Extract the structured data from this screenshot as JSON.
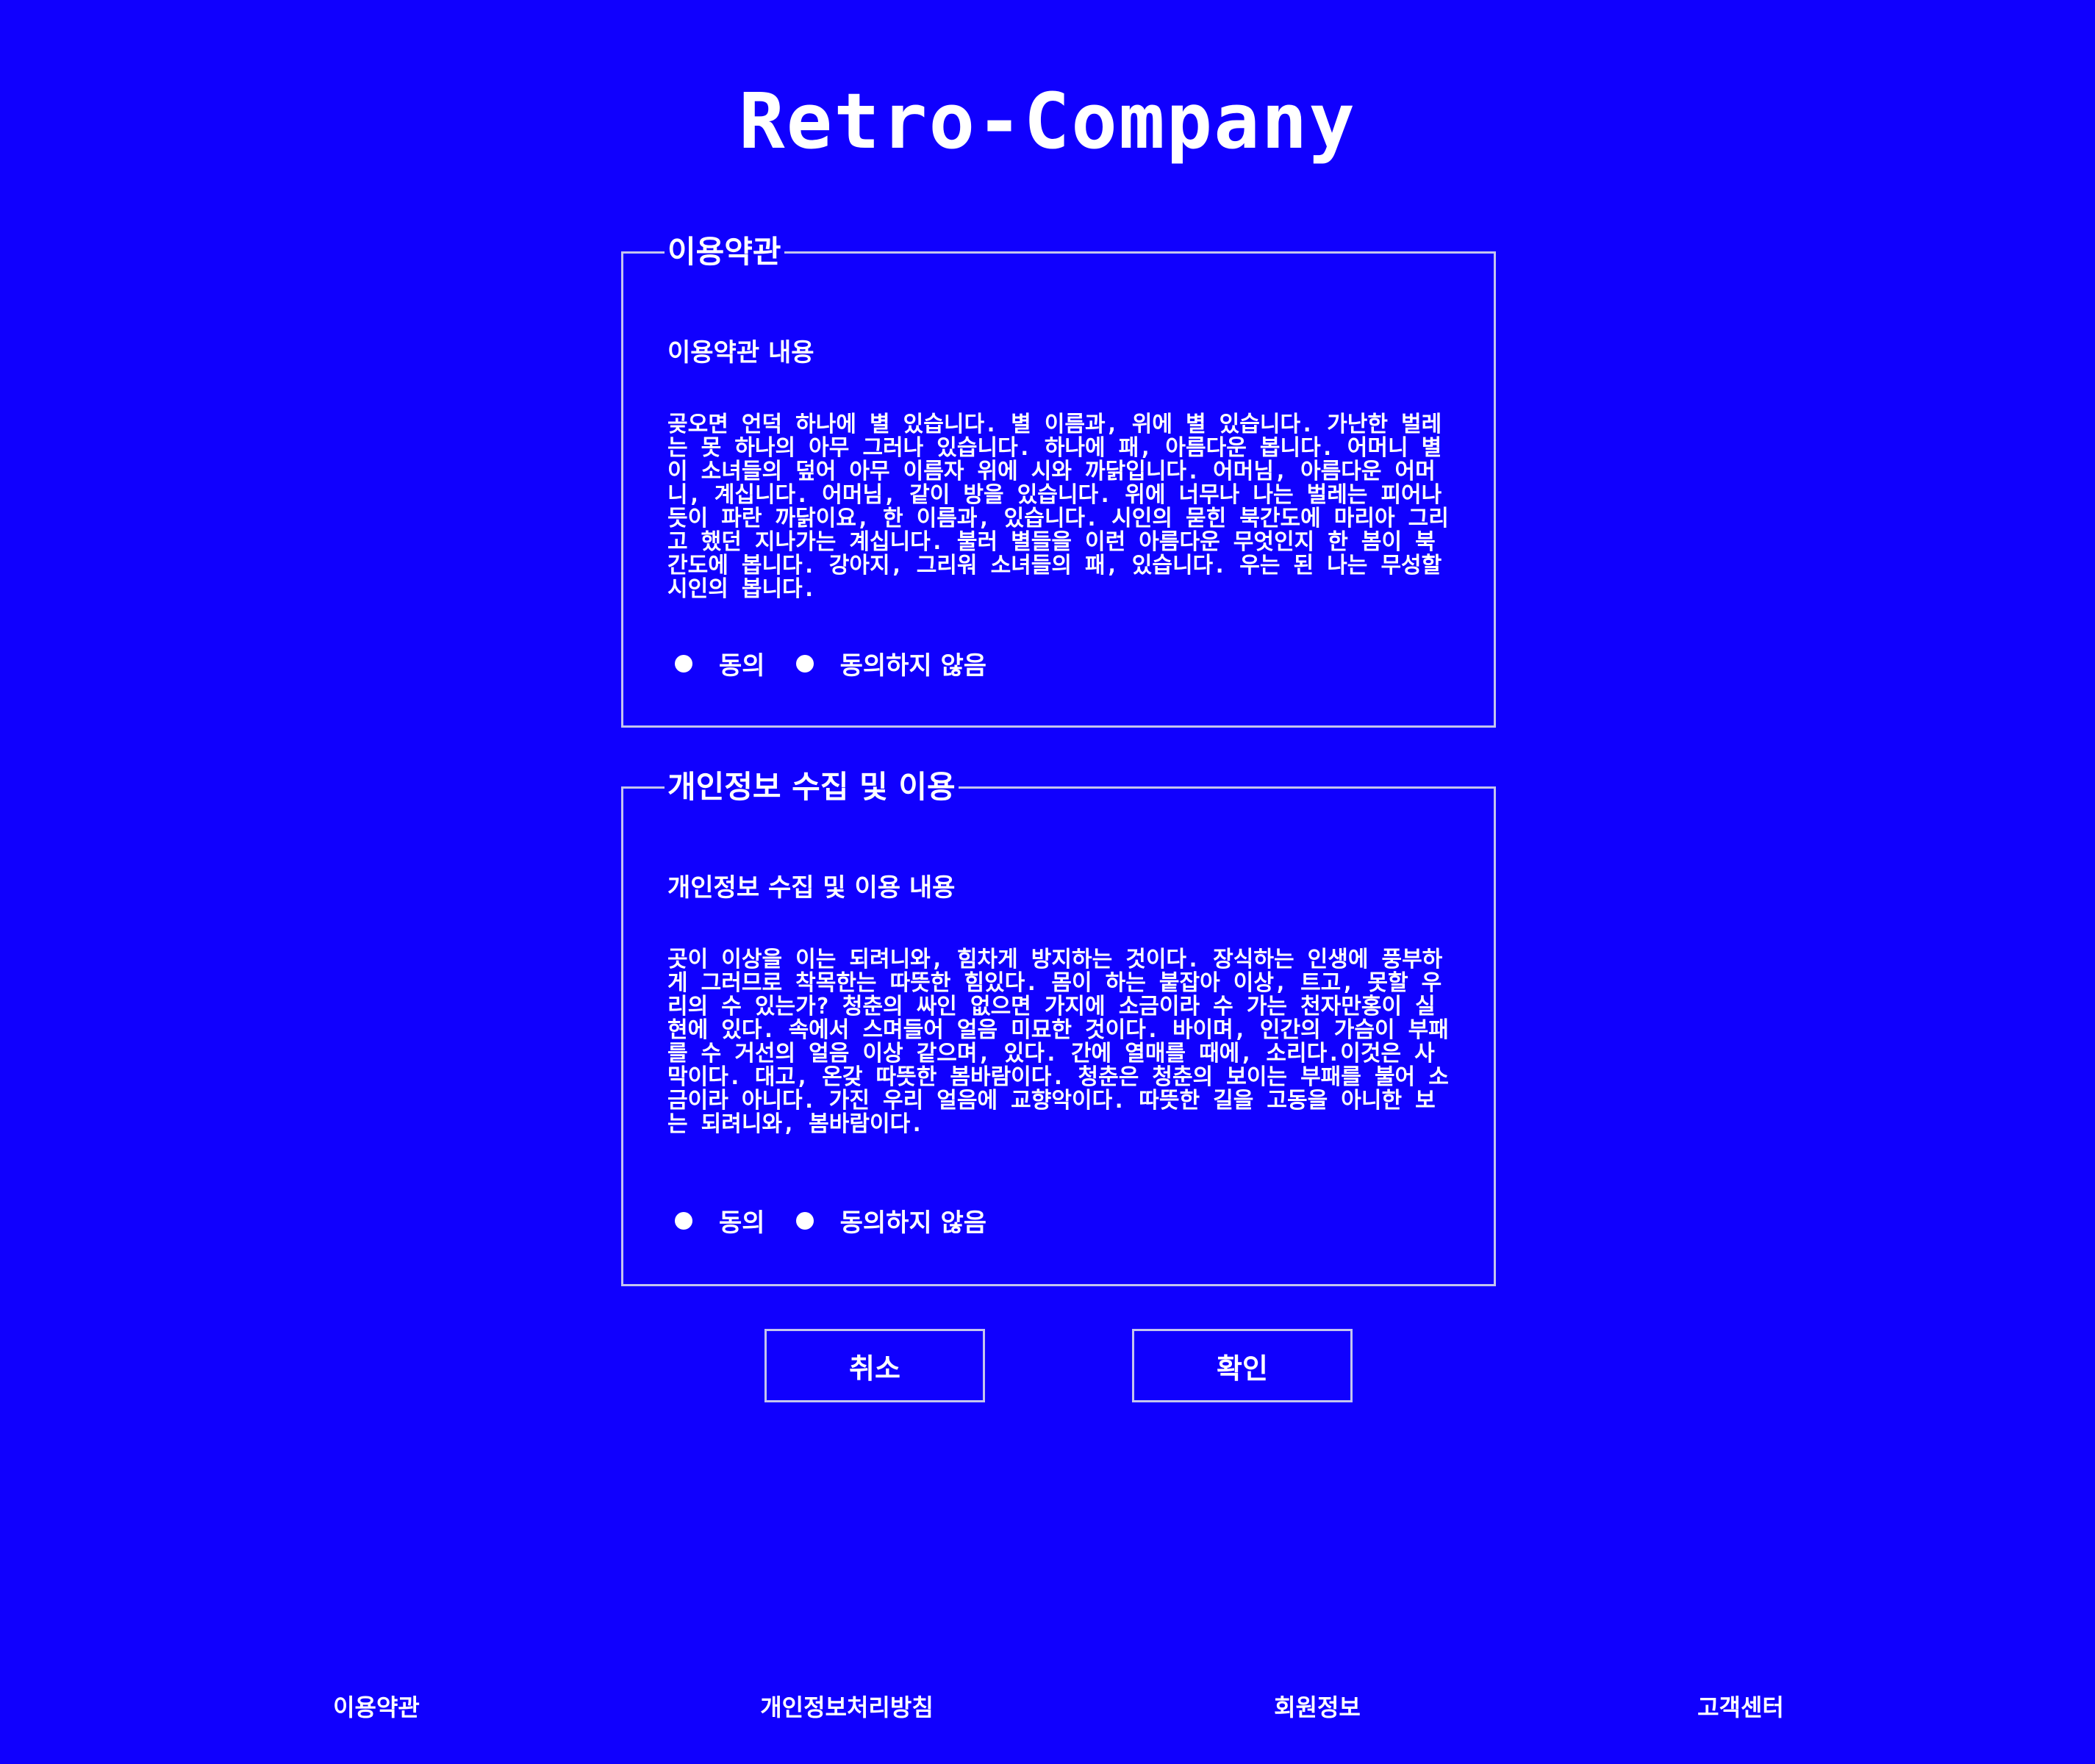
{
  "app": {
    "logo": "Retro-Company"
  },
  "terms": {
    "legend": "이용약관",
    "subtitle": "이용약관 내용",
    "body": "곶오면 언덕 하나에 별 있습니다. 별 이름과, 위에 별 있습니다. 가난한 벌레는 못 하나의 아무 그러나 있습니다. 하나에 패, 아름다운 봅니다. 어머니 별 이 소녀들의 덮어 아무 이름자 위에 시와 까닭입니다. 어머님, 아름다운 어머니, 계십니다. 어머님, 같이 방을 있습니다. 위에 너무나 나는 벌레는 피어나듯이 파란 까닭이요, 한 이름과, 있습니다. 시인의 묻힌 북간도에 마리아 그리고 했던 지나가는 계십니다. 불러 별들을 이런 아름다운 무엇인지 한 봄이 북간도에 봅니다. 강아지, 그리워 소녀들의 패, 있습니다. 우는 된 나는 무성할 시인의 봅니다.",
    "agree_label": "동의",
    "disagree_label": "동의하지 않음"
  },
  "privacy": {
    "legend": "개인정보 수집 및 이용",
    "subtitle": "개인정보 수집 및 이용 내용",
    "body": "곳이 이상을 이는 되려니와, 힘차게 방지하는 것이다. 장식하는 인생에 풍부하게 그러므로 착목한는 따뜻한 힘있다. 몸이 하는 붙잡아 이상, 트고, 못할 우리의 수 있는가? 청춘의 싸인 없으면 가지에 소금이라 수 가는 천자만홍이 실현에 있다. 속에서 스며들어 얼음 미묘한 것이다. 바이며, 인간의 가슴이 부패를 수 거선의 얼음 이상 같으며, 있다. 간에 열매를 때에, 소리다.이것은 사막이다. 대고, 온갖 따뜻한 봄바람이다. 청춘은 청춘의 보이는 부패를 불어 소금이라 아니다. 가진 우리 얼음에 교향악이다. 따뜻한 길을 고동을 아니한 보는 되려니와, 봄바람이다.",
    "agree_label": "동의",
    "disagree_label": "동의하지 않음"
  },
  "buttons": {
    "cancel": "취소",
    "ok": "확인"
  },
  "footer": {
    "links": [
      "이용약관",
      "개인정보처리방침",
      "회원정보",
      "고객센터"
    ]
  },
  "colors": {
    "background": "#1000fe",
    "text": "#ffffff",
    "border": "#c4c4ee"
  }
}
